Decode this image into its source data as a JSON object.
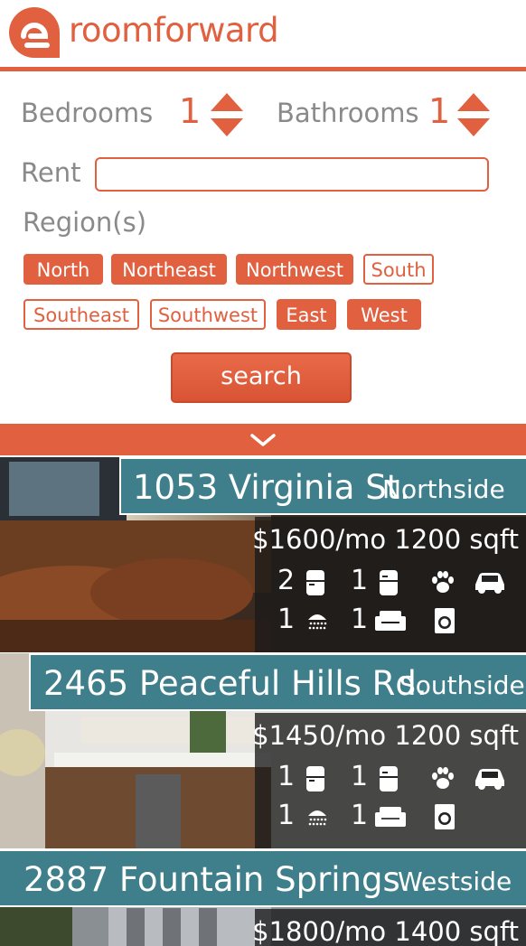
{
  "app": {
    "name": "roomforward"
  },
  "filters": {
    "bedrooms_label": "Bedrooms",
    "bedrooms_value": "1",
    "bathrooms_label": "Bathrooms",
    "bathrooms_value": "1",
    "rent_label": "Rent",
    "rent_value": "",
    "regions_label": "Region(s)",
    "regions": [
      {
        "label": "North",
        "selected": true
      },
      {
        "label": "Northeast",
        "selected": true
      },
      {
        "label": "Northwest",
        "selected": true
      },
      {
        "label": "South",
        "selected": false
      },
      {
        "label": "Southeast",
        "selected": false
      },
      {
        "label": "Southwest",
        "selected": false
      },
      {
        "label": "East",
        "selected": true
      },
      {
        "label": "West",
        "selected": true
      }
    ],
    "search_label": "search"
  },
  "listings": [
    {
      "address": "1053 Virginia St.",
      "neighborhood": "Northside",
      "price": "$1600/mo",
      "sqft": "1200 sqft",
      "bedrooms": "2",
      "fridges": "1",
      "bathrooms": "1",
      "couches": "1"
    },
    {
      "address": "2465 Peaceful Hills Rd.",
      "neighborhood": "Southside",
      "price": "$1450/mo",
      "sqft": "1200 sqft",
      "bedrooms": "1",
      "fridges": "1",
      "bathrooms": "1",
      "couches": "1"
    },
    {
      "address": "2887 Fountain Springs...",
      "neighborhood": "Westside",
      "price": "$1800/mo",
      "sqft": "1400 sqft"
    }
  ],
  "colors": {
    "accent": "#e0603f",
    "title_bg": "#3e7f8b",
    "label_gray": "#8a8a8a"
  },
  "icons": [
    "logo-icon",
    "stepper-up-icon",
    "stepper-down-icon",
    "chevron-down-icon",
    "fridge-icon",
    "pet-icon",
    "car-icon",
    "shower-icon",
    "couch-icon",
    "washer-icon"
  ]
}
